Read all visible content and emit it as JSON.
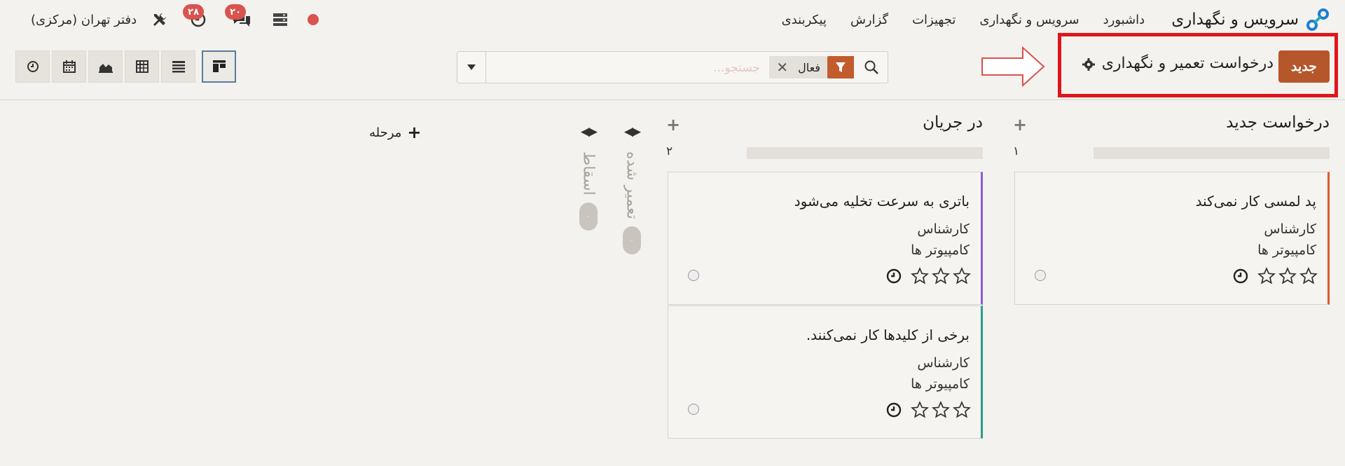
{
  "navbar": {
    "app_name": "سرویس و نگهداری",
    "menu": [
      "داشبورد",
      "سرویس و نگهداری",
      "تجهیزات",
      "گزارش",
      "پیکربندی"
    ],
    "company": "دفتر تهران (مرکزی)",
    "activity_count": "۲۸",
    "messages_count": "۲۰",
    "status_color": "#d9534f"
  },
  "control": {
    "new_label": "جدید",
    "title": "درخواست تعمیر و نگهداری",
    "search_placeholder": "جستجو...",
    "facet_value": "فعال",
    "views": [
      "kanban-icon",
      "list-icon",
      "pivot-icon",
      "graph-icon",
      "calendar-icon",
      "activity-icon"
    ]
  },
  "columns": [
    {
      "title": "درخواست جدید",
      "count": "۱",
      "cards": [
        {
          "title": "پد لمسی کار نمی‌کند",
          "line1": "کارشناس",
          "line2": "کامپیوتر ها",
          "accent": "#e0592a"
        }
      ]
    },
    {
      "title": "در جریان",
      "count": "۲",
      "cards": [
        {
          "title": "باتری به سرعت تخلیه می‌شود",
          "line1": "کارشناس",
          "line2": "کامپیوتر ها",
          "accent": "#8e5bd6"
        },
        {
          "title": "برخی از کلیدها کار نمی‌کنند.",
          "line1": "کارشناس",
          "line2": "کامپیوتر ها",
          "accent": "#2a9d8f"
        }
      ]
    }
  ],
  "folded": [
    {
      "title": "تعمیر شده",
      "count": "۰"
    },
    {
      "title": "اسقاط",
      "count": "۰"
    }
  ],
  "add_stage_label": "مرحله",
  "colors": {
    "primary": "#b5562b",
    "highlight": "#e0151b",
    "background": "#f3f2ee"
  }
}
